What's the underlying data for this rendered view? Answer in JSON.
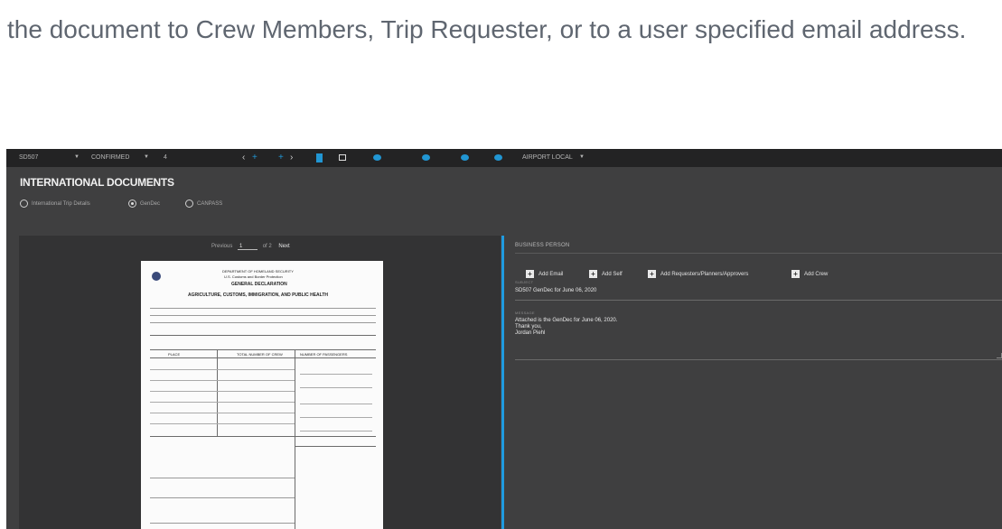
{
  "intro": {
    "text": "the document to Crew Members, Trip Requester, or to a user specified email address."
  },
  "toolbar": {
    "tail_number": "SD507",
    "status": "CONFIRMED",
    "status_extra": "4",
    "time_mode": "AIRPORT LOCAL"
  },
  "page": {
    "title": "INTERNATIONAL DOCUMENTS"
  },
  "doc_type": {
    "options": [
      "International Trip Details",
      "GenDec",
      "CANPASS"
    ],
    "selected": "GenDec"
  },
  "pager": {
    "previous": "Previous",
    "current": "1",
    "of_total": "of 2",
    "next": "Next"
  },
  "document": {
    "agency_line1": "DEPARTMENT OF HOMELAND SECURITY",
    "agency_line2": "U.S. Customs and Border Protection",
    "title": "GENERAL DECLARATION",
    "subtitle": "AGRICULTURE, CUSTOMS, IMMIGRATION, AND PUBLIC HEALTH",
    "col_place": "PLACE",
    "col_total": "TOTAL NUMBER OF CREW",
    "col_passengers": "NUMBER OF PASSENGERS"
  },
  "email": {
    "recipient_section": "BUSINESS PERSON",
    "buttons": [
      "Add Email",
      "Add Self",
      "Add Requesters/Planners/Approvers",
      "Add Crew"
    ],
    "subject_label": "SUBJECT",
    "subject": "SD507 GenDec for June 06, 2020",
    "message_label": "MESSAGE",
    "message_lines": [
      "Attached is the GenDec for June 06, 2020.",
      "Thank you,",
      "Jordan Piehl"
    ]
  }
}
